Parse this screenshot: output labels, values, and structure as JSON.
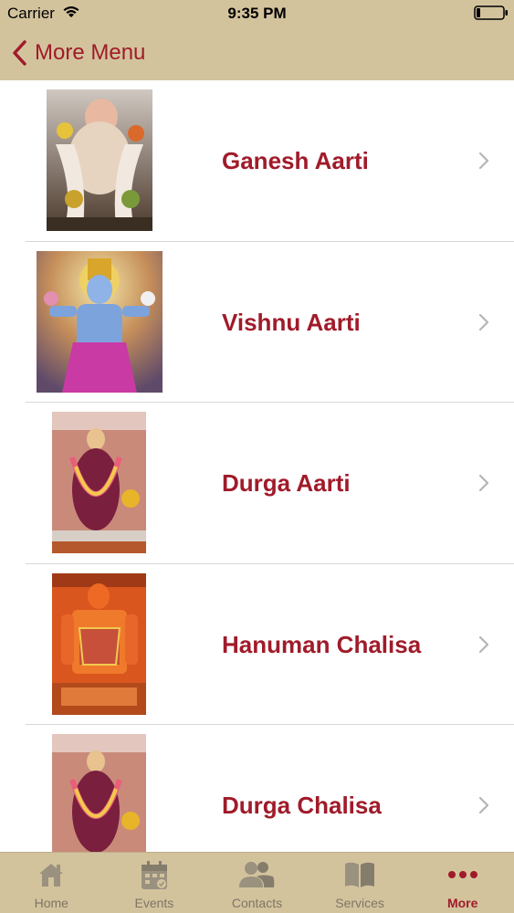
{
  "status_bar": {
    "carrier": "Carrier",
    "time": "9:35 PM"
  },
  "nav": {
    "back_label": "More Menu"
  },
  "list": {
    "items": [
      {
        "label": "Ganesh Aarti",
        "image_icon": "ganesh-image-icon"
      },
      {
        "label": "Vishnu Aarti",
        "image_icon": "vishnu-image-icon"
      },
      {
        "label": "Durga Aarti",
        "image_icon": "durga-image-icon"
      },
      {
        "label": "Hanuman Chalisa",
        "image_icon": "hanuman-image-icon"
      },
      {
        "label": "Durga Chalisa",
        "image_icon": "durga-image-icon"
      }
    ]
  },
  "tabs": [
    {
      "label": "Home",
      "icon": "home-icon",
      "active": false
    },
    {
      "label": "Events",
      "icon": "calendar-icon",
      "active": false
    },
    {
      "label": "Contacts",
      "icon": "people-icon",
      "active": false
    },
    {
      "label": "Services",
      "icon": "book-icon",
      "active": false
    },
    {
      "label": "More",
      "icon": "more-dots-icon",
      "active": true
    }
  ],
  "colors": {
    "accent": "#a01b2a",
    "bar_bg": "#d3c39d",
    "inactive": "#7d7565"
  }
}
